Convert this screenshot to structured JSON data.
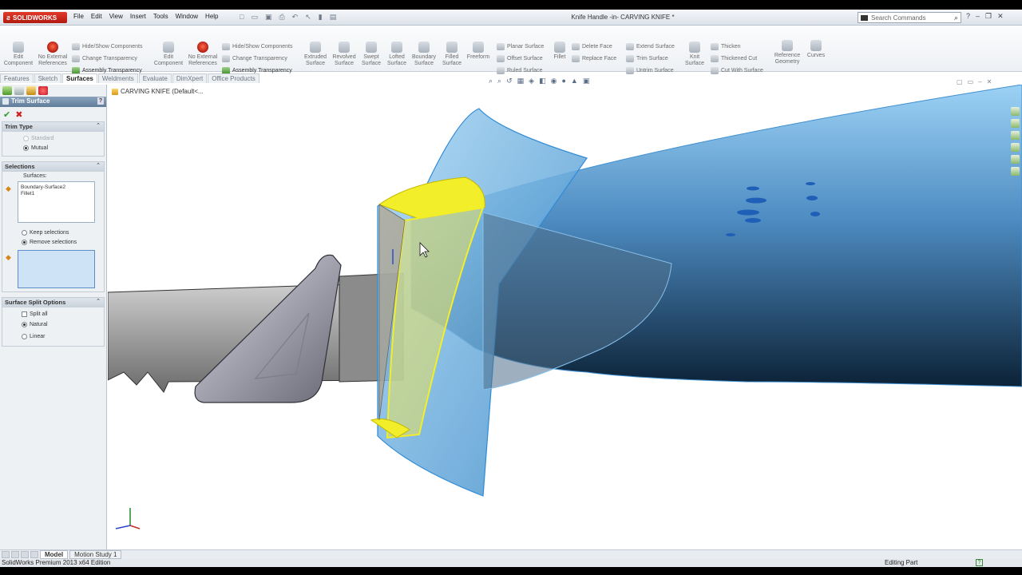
{
  "app": {
    "logo": "SOLIDWORKS",
    "document_title": "Knife Handle -in- CARVING KNIFE *"
  },
  "menu": [
    "File",
    "Edit",
    "View",
    "Insert",
    "Tools",
    "Window",
    "Help"
  ],
  "search": {
    "placeholder": "Search Commands"
  },
  "ribbon": {
    "edit_component": "Edit Component",
    "no_external_refs": "No External References",
    "hide_show_components": "Hide/Show Components",
    "change_transparency": "Change Transparency",
    "assembly_transparency": "Assembly Transparency",
    "edit_component_2": "Edit Component",
    "no_external_refs_2": "No External References",
    "hide_show_components_2": "Hide/Show Components",
    "change_transparency_2": "Change Transparency",
    "assembly_transparency_2": "Assembly Transparency",
    "extruded_surface": "Extruded Surface",
    "revolved_surface": "Revolved Surface",
    "swept_surface": "Swept Surface",
    "lofted_surface": "Lofted Surface",
    "boundary_surface": "Boundary Surface",
    "filled_surface": "Filled Surface",
    "freeform": "Freeform",
    "planar_surface": "Planar Surface",
    "offset_surface": "Offset Surface",
    "ruled_surface": "Ruled Surface",
    "fillet": "Fillet",
    "delete_face": "Delete Face",
    "replace_face": "Replace Face",
    "extend_surface": "Extend Surface",
    "trim_surface": "Trim Surface",
    "untrim_surface": "Untrim Surface",
    "knit_surface": "Knit Surface",
    "thicken": "Thicken",
    "thickened_cut": "Thickened Cut",
    "cut_with_surface": "Cut With Surface",
    "reference_geometry": "Reference Geometry",
    "curves": "Curves"
  },
  "tabs": [
    "Features",
    "Sketch",
    "Surfaces",
    "Weldments",
    "Evaluate",
    "DimXpert",
    "Office Products"
  ],
  "active_tab": "Surfaces",
  "property_manager": {
    "title": "Trim Surface",
    "help": "?",
    "trim_type": {
      "header": "Trim Type",
      "standard": "Standard",
      "mutual": "Mutual"
    },
    "selections": {
      "header": "Selections",
      "surfaces_label": "Surfaces:",
      "items": [
        "Boundary-Surface2",
        "Fillet1"
      ],
      "keep_selections": "Keep selections",
      "remove_selections": "Remove selections"
    },
    "split_options": {
      "header": "Surface Split Options",
      "split_all": "Split all",
      "natural": "Natural",
      "linear": "Linear"
    }
  },
  "tree": {
    "root": "CARVING KNIFE  (Default<..."
  },
  "bottom_tabs": [
    "Model",
    "Motion Study 1"
  ],
  "status": {
    "left": "SolidWorks Premium 2013 x64 Edition",
    "right": "Editing Part"
  },
  "colors": {
    "accent": "#5b7fa3",
    "surface": "#6fb5e6",
    "highlight_yellow": "#f2ef2a",
    "logo_red": "#d42a1b"
  }
}
